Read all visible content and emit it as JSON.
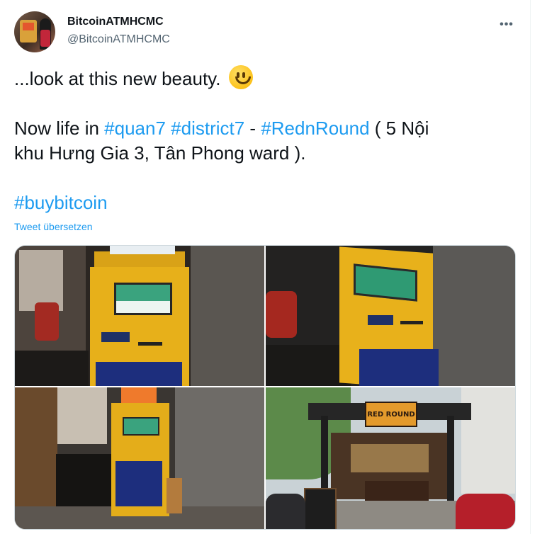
{
  "tweet": {
    "author": {
      "display_name": "BitcoinATMHCMC",
      "handle": "@BitcoinATMHCMC",
      "avatar_icon": "profile-photo-atm"
    },
    "more_icon": "more-horizontal-icon",
    "body": {
      "line1_text": "...look at this new beauty.",
      "line1_emoji": "slightly-smiling-face-emoji",
      "line2_prefix": "Now life in ",
      "hashtag_quan7": "#quan7",
      "space_between": " ",
      "hashtag_district7": "#district7",
      "dash": " - ",
      "hashtag_rednround": "#RednRound",
      "line2_suffix": " ( 5 Nội",
      "line3_text": "khu Hưng Gia 3, Tân Phong ward ).",
      "hashtag_buybitcoin": "#buybitcoin"
    },
    "translate_label": "Tweet übersetzen",
    "photos": [
      {
        "name": "yellow bitcoin atm indoor front",
        "sign_text": ""
      },
      {
        "name": "yellow bitcoin atm angled",
        "sign_text": ""
      },
      {
        "name": "bitcoin atm with bitcoin logo sign",
        "sign_text": ""
      },
      {
        "name": "red n round cafe storefront",
        "sign_text": "RED ROUND"
      }
    ],
    "colors": {
      "link": "#1d9bf0",
      "text": "#0f1419",
      "secondary": "#536471",
      "atm_yellow": "#e7b01a",
      "atm_blue": "#1d2e7d"
    }
  }
}
